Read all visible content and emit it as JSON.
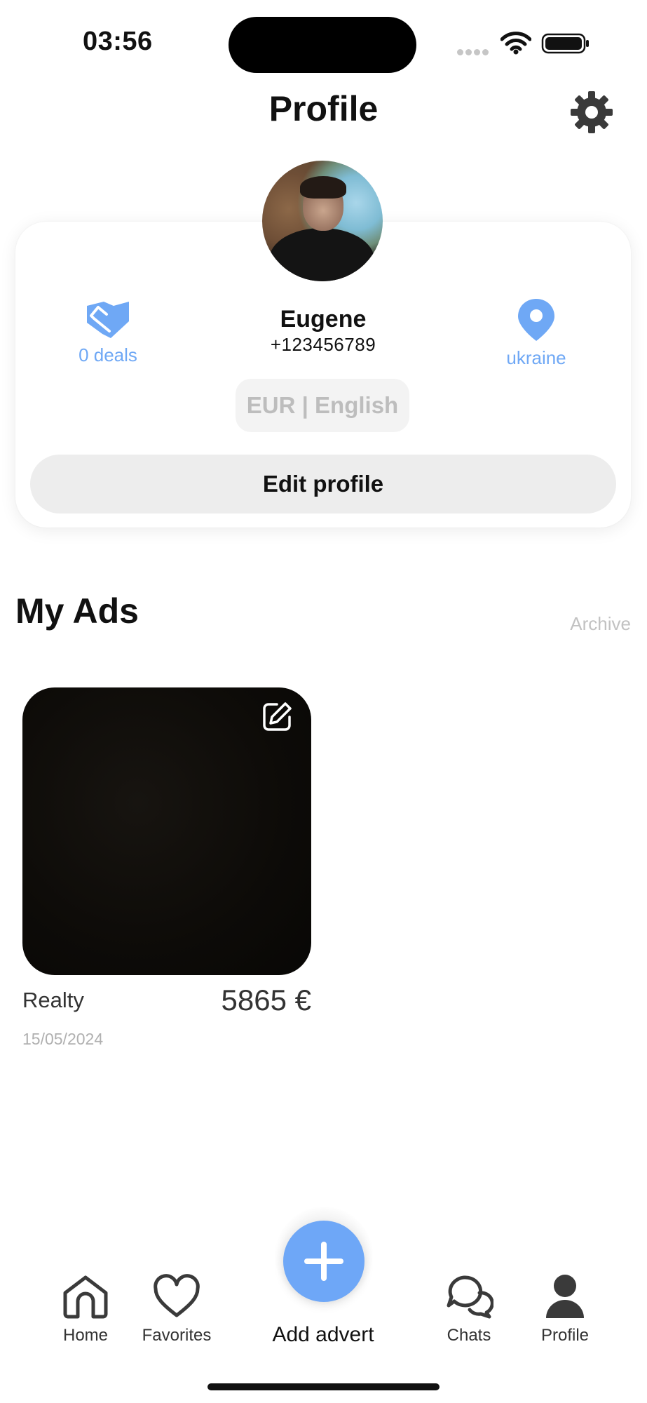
{
  "status_bar": {
    "time": "03:56"
  },
  "header": {
    "title": "Profile",
    "settings_icon": "gear-icon"
  },
  "profile": {
    "name": "Eugene",
    "phone": "+123456789",
    "deals_label": "0 deals",
    "deals_icon": "handshake-icon",
    "location_label": "ukraine",
    "location_icon": "map-pin-icon",
    "currency_language": "EUR | English",
    "edit_button": "Edit profile",
    "accent_color": "#6fa8f5"
  },
  "my_ads": {
    "title": "My Ads",
    "archive_label": "Archive",
    "items": [
      {
        "category": "Realty",
        "price": "5865 €",
        "date": "15/05/2024",
        "edit_icon": "edit-icon"
      }
    ]
  },
  "tab_bar": {
    "items": [
      {
        "label": "Home",
        "icon": "home-icon"
      },
      {
        "label": "Favorites",
        "icon": "heart-icon"
      },
      {
        "label": "Chats",
        "icon": "chat-bubbles-icon"
      },
      {
        "label": "Profile",
        "icon": "user-icon"
      }
    ],
    "add_advert_label": "Add advert",
    "add_icon": "plus-icon",
    "fab_color": "#6ea7f7"
  }
}
